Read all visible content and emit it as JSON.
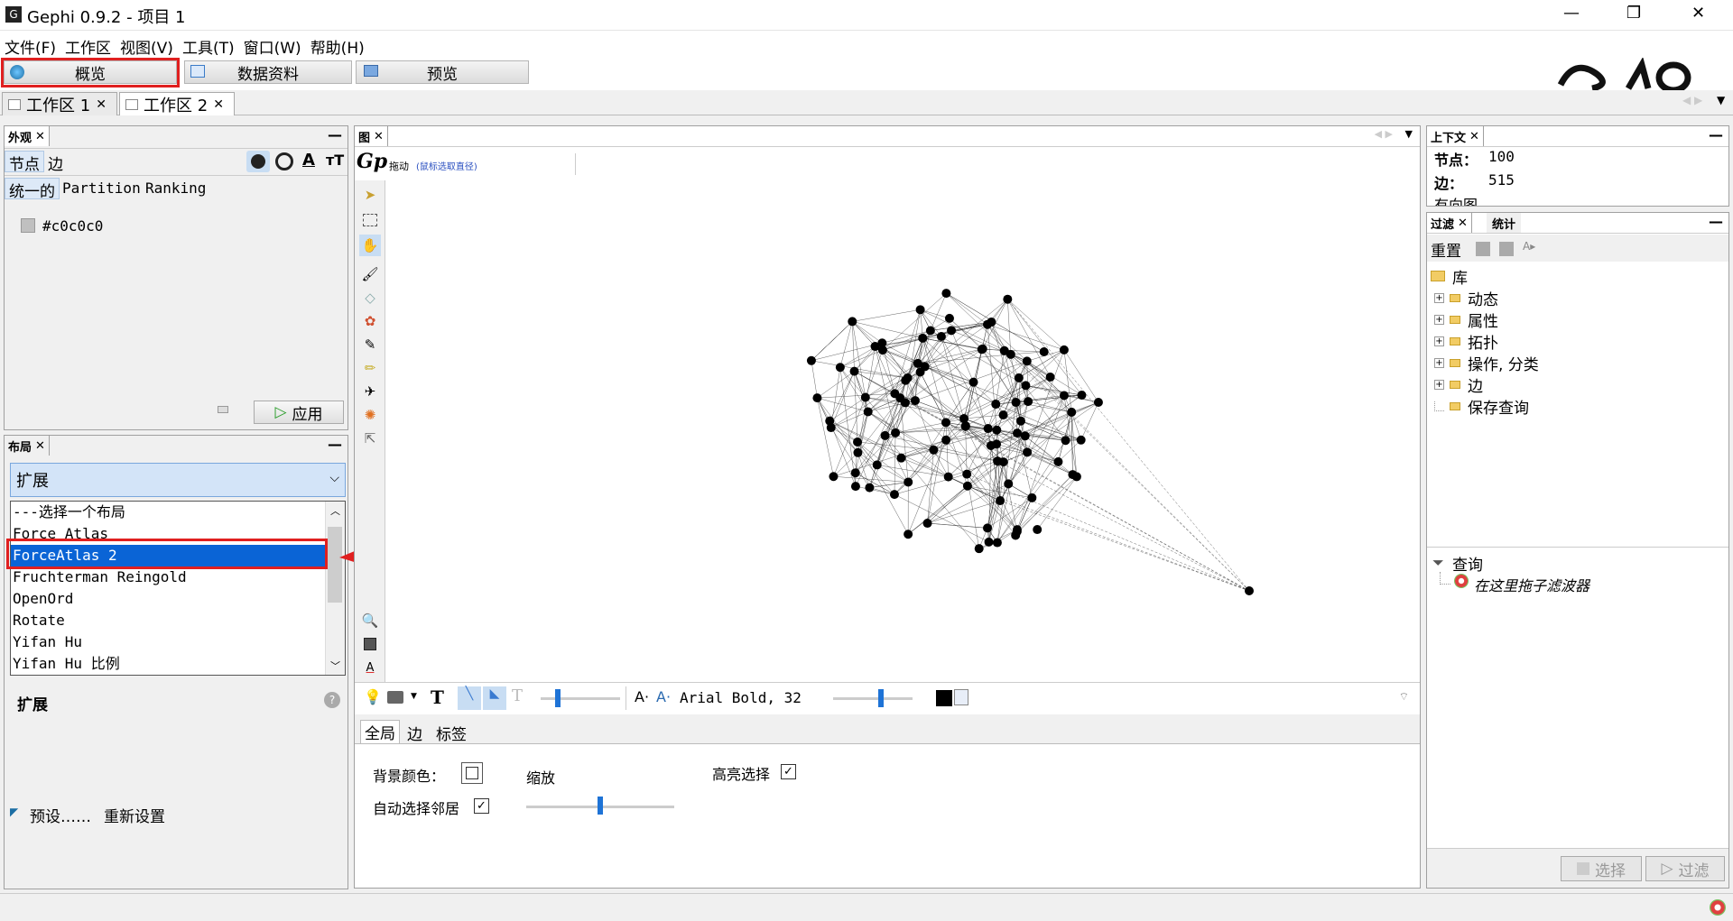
{
  "window": {
    "title": "Gephi 0.9.2 - 项目 1",
    "controls": {
      "minimize": "—",
      "maximize": "❐",
      "close": "✕"
    }
  },
  "menu": [
    "文件(F)",
    "工作区",
    "视图(V)",
    "工具(T)",
    "窗口(W)",
    "帮助(H)"
  ],
  "modes": {
    "overview": "概览",
    "data_lab": "数据资料",
    "preview": "预览"
  },
  "workspaces": [
    {
      "label": "工作区 1",
      "close": "✕"
    },
    {
      "label": "工作区 2",
      "close": "✕"
    }
  ],
  "appearance": {
    "tab": "外观",
    "subtabs": {
      "nodes": "节点",
      "edges": "边"
    },
    "modes": {
      "unique": "统一的",
      "partition": "Partition",
      "ranking": "Ranking"
    },
    "color_value": "#c0c0c0",
    "apply": "应用"
  },
  "layout": {
    "tab": "布局",
    "selected": "扩展",
    "options": [
      "---选择一个布局",
      "Force Atlas",
      "ForceAtlas 2",
      "Fruchterman Reingold",
      "OpenOrd",
      "Rotate",
      "Yifan Hu",
      "Yifan Hu 比例"
    ],
    "highlighted_index": 2,
    "desc_title": "扩展",
    "presets": "预设……",
    "reset": "重新设置"
  },
  "graph": {
    "tab": "图",
    "drag_label": "拖动",
    "drag_hint": "(鼠标选取直径)",
    "label_font": "Arial Bold, 32",
    "settings_tabs": {
      "global": "全局",
      "edges": "边",
      "labels": "标签"
    },
    "bg_color_label": "背景颜色：",
    "zoom_label": "缩放",
    "highlight_label": "高亮选择",
    "auto_select_label": "自动选择邻居",
    "highlight_checked": true,
    "auto_select_checked": true,
    "zoom_level": 0.5
  },
  "context": {
    "tab": "上下文",
    "nodes_label": "节点：",
    "nodes_value": "100",
    "edges_label": "边：",
    "edges_value": "515",
    "graph_type": "有向图"
  },
  "filters": {
    "tab_filter": "过滤",
    "tab_stats": "统计",
    "reset": "重置",
    "library": "库",
    "items": [
      "动态",
      "属性",
      "拓扑",
      "操作, 分类",
      "边",
      "保存查询"
    ],
    "query": "查询",
    "drop_hint": "在这里拖子滤波器",
    "select_btn": "选择",
    "filter_btn": "过滤"
  },
  "annotation": {
    "color": "#e02020"
  },
  "chart_data": {
    "type": "scatter",
    "nodes": 100,
    "edges": 515
  }
}
